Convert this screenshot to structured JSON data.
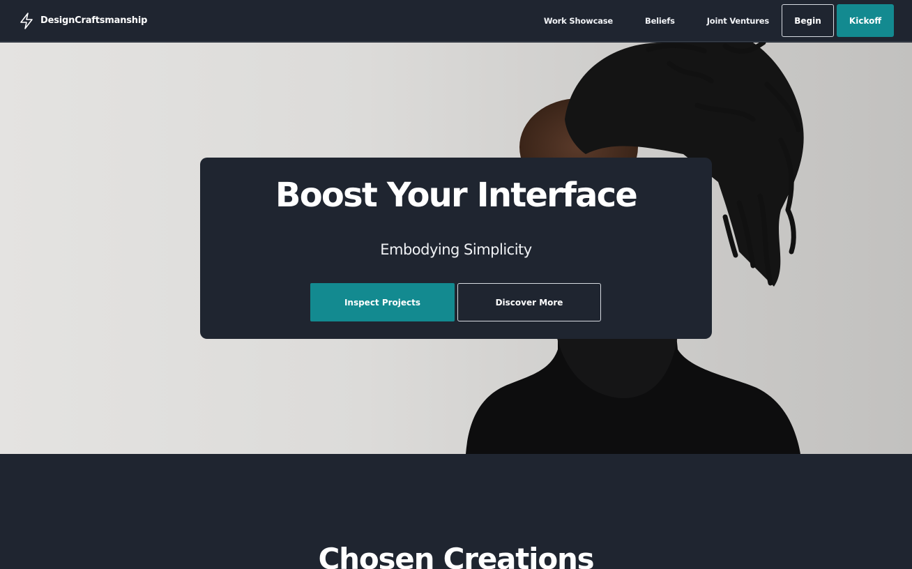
{
  "nav": {
    "brand_icon": "lightning-bolt-icon",
    "brand_name": "DesignCraftsmanship",
    "links": [
      "Work Showcase",
      "Beliefs",
      "Joint Ventures"
    ],
    "begin_label": "Begin",
    "kickoff_label": "Kickoff"
  },
  "hero": {
    "title": "Boost Your Interface",
    "subtitle": "Embodying Simplicity",
    "primary_label": "Inspect Projects",
    "secondary_label": "Discover More"
  },
  "section": {
    "title": "Chosen Creations"
  },
  "colors": {
    "background": "#1f2530",
    "accent": "#138a90",
    "text": "#ffffff"
  }
}
